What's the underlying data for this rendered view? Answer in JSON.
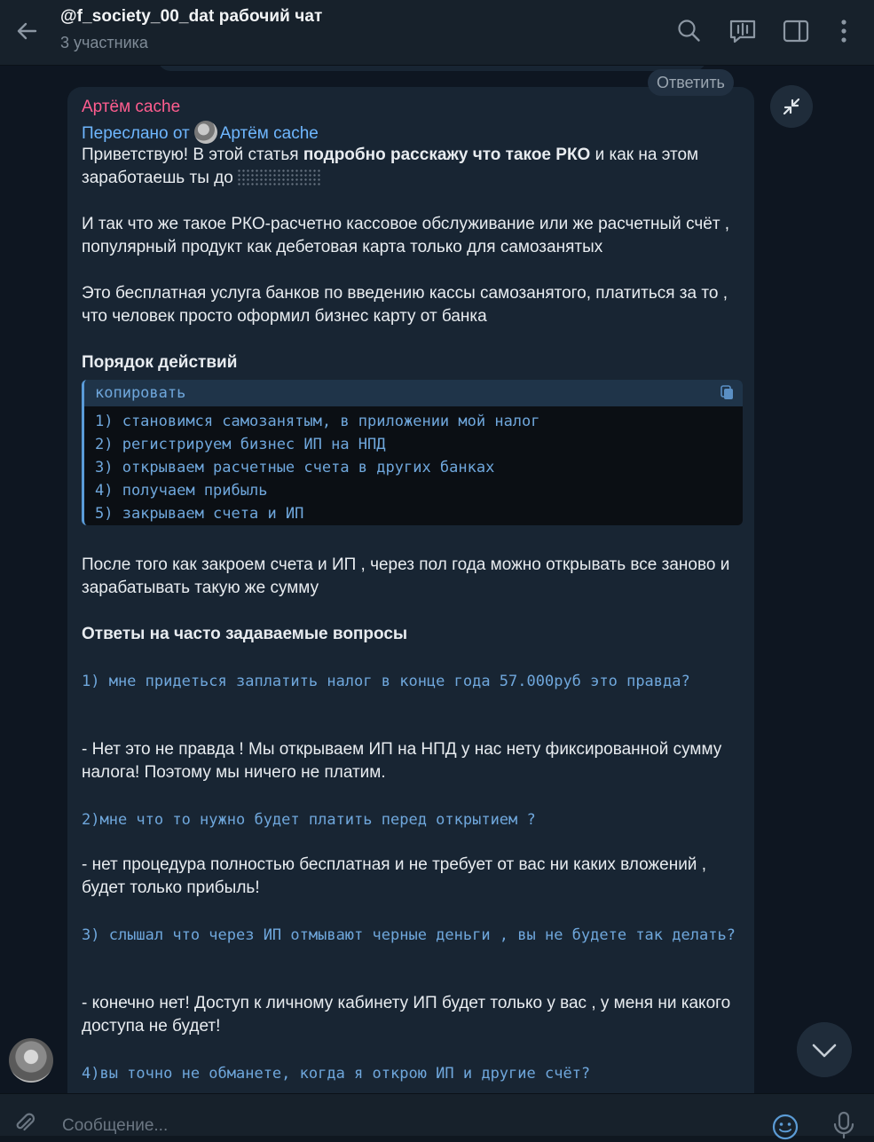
{
  "header": {
    "title": "@f_society_00_dat рабочий чат",
    "subtitle": "3 участника"
  },
  "message": {
    "author": "Артём cache",
    "forwarded_prefix": "Переслано от",
    "forwarded_from": "Артём cache",
    "reply_label": "Ответить",
    "p1_part1": "Приветствую! В этой статья ",
    "p1_bold": "подробно расскажу что такое РКО",
    "p1_part2": " и как на этом заработаешь ты до",
    "p2": "И так что же такое РКО-расчетно кассовое обслуживание или же расчетный счёт , популярный продукт как дебетовая карта только для самозанятых",
    "p3": "Это бесплатная услуга банков по введению кассы самозанятого, платиться за то , что человек просто оформил бизнес карту от банка",
    "steps_heading": "Порядок действий",
    "code": {
      "copy_label": "копировать",
      "lines": [
        "1) становимся самозанятым, в приложении мой налог",
        "2) регистрируем бизнес ИП на НПД",
        "3) открываем расчетные счета в других банках",
        "4) получаем прибыль",
        "5) закрываем счета и ИП"
      ]
    },
    "p4": "После того как закроем счета и ИП , через пол года можно открывать все заново и зарабатывать такую же сумму",
    "faq_heading": "Ответы на часто задаваемые вопросы",
    "q1": "1) мне придеться заплатить налог в конце года 57.000руб это правда?",
    "a1": "- Нет это не правда ! Мы открываем ИП на НПД у нас нету фиксированной сумму налога! Поэтому мы ничего не платим.",
    "q2": "2)мне что то нужно будет платить  перед открытием ?",
    "a2": "- нет процедура полностью бесплатная и не требует от вас ни каких вложений , будет только прибыль!",
    "q3": "3) слышал что через ИП отмывают черные деньги , вы не будете так делать?",
    "a3": "- конечно нет! Доступ к личному кабинету ИП будет только у вас , у меня ни какого доступа не будет!",
    "q4": "4)вы точно не обманете, когда я открою ИП и другие счёт?"
  },
  "composer": {
    "placeholder": "Сообщение..."
  },
  "colors": {
    "author": "#ff5d8f",
    "forward": "#6fb7ff",
    "code": "#6fa7dc",
    "bubble": "#182533"
  }
}
